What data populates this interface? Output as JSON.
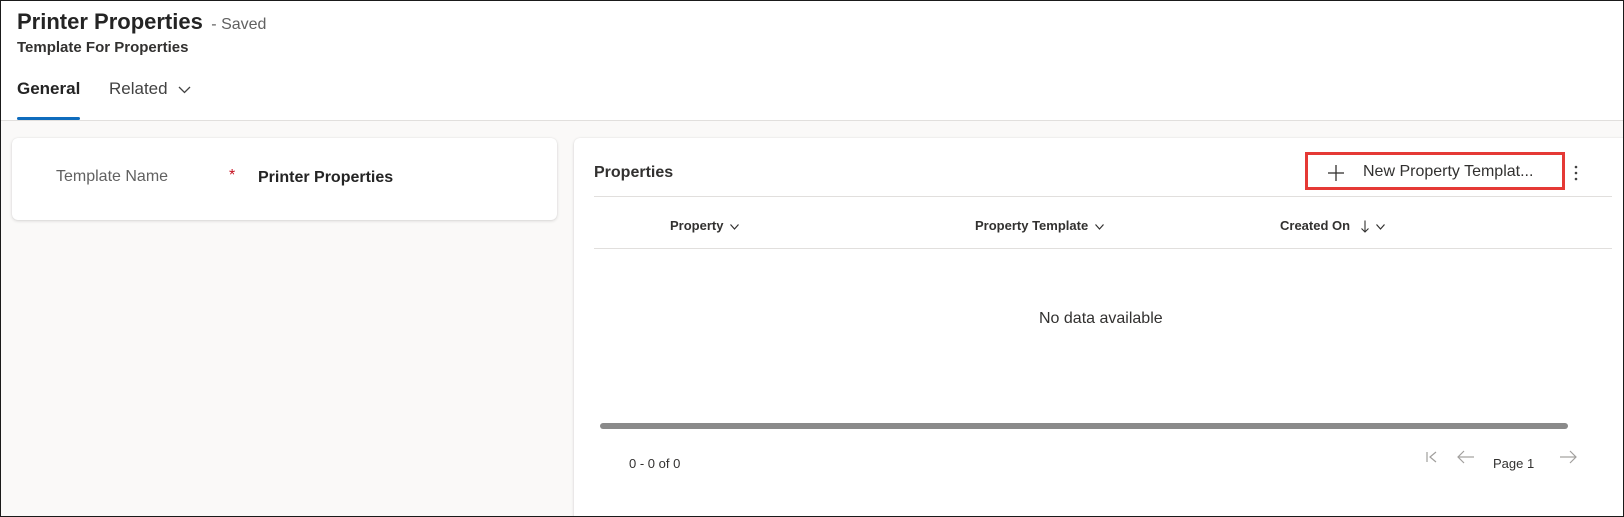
{
  "header": {
    "title": "Printer Properties",
    "save_status": "- Saved",
    "subtitle": "Template For Properties",
    "tabs": [
      {
        "label": "General",
        "selected": true
      },
      {
        "label": "Related",
        "selected": false,
        "has_dropdown": true
      }
    ]
  },
  "form": {
    "template_name_label": "Template Name",
    "required_marker": "*",
    "template_name_value": "Printer Properties"
  },
  "properties_grid": {
    "title": "Properties",
    "new_button_label": "New Property Templat...",
    "new_button_icon": "plus-icon",
    "more_icon": "more-vertical-icon",
    "columns": [
      {
        "label": "Property",
        "sort": "none"
      },
      {
        "label": "Property Template",
        "sort": "none"
      },
      {
        "label": "Created On",
        "sort": "descending"
      }
    ],
    "empty_message": "No data available",
    "record_count": "0 - 0 of 0",
    "page_label": "Page 1"
  },
  "colors": {
    "accent": "#0f6cbd",
    "highlight_border": "#e53935",
    "required": "#c50f1f",
    "background": "#faf9f8"
  }
}
